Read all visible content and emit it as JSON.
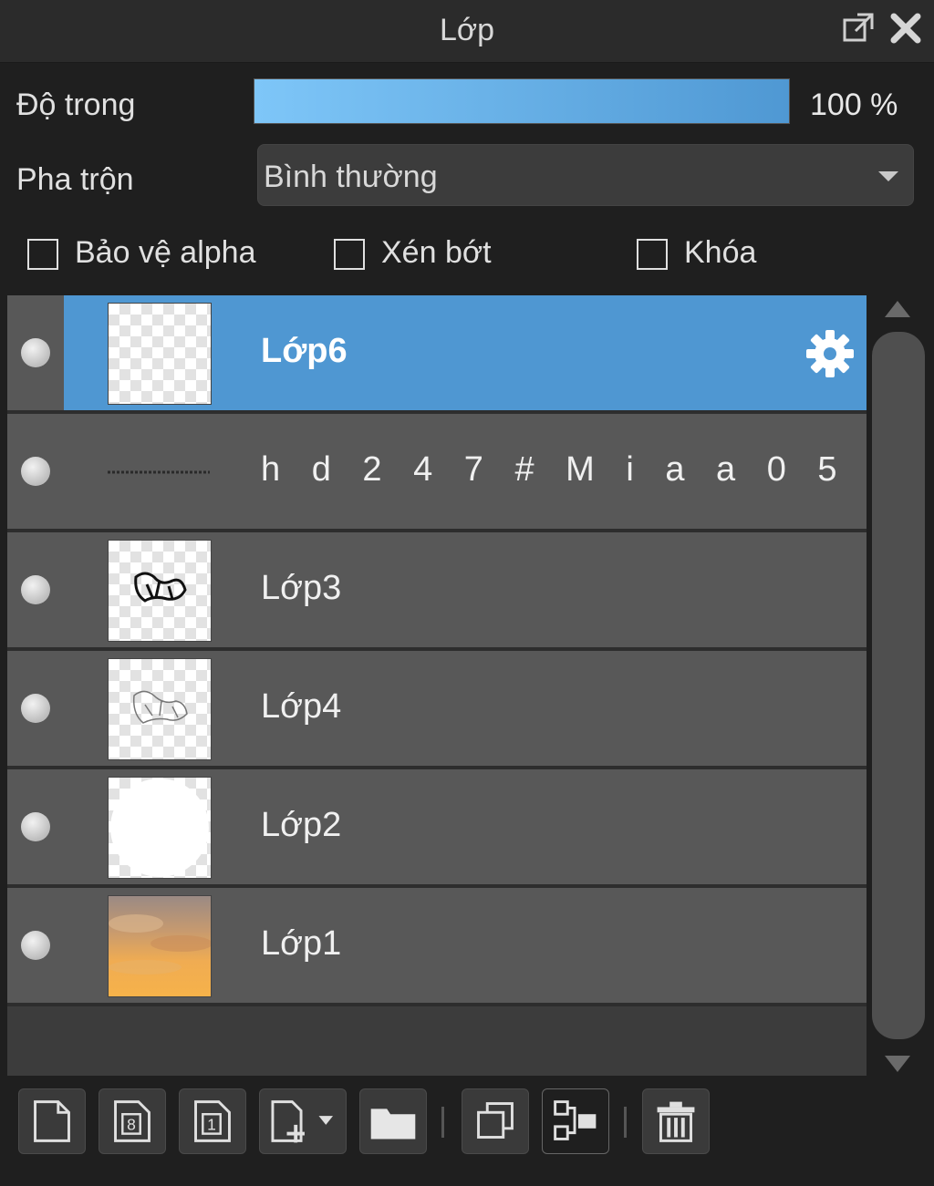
{
  "window": {
    "title": "Lớp"
  },
  "opacity": {
    "label": "Độ trong",
    "value_text": "100 %",
    "value": 100
  },
  "blend": {
    "label": "Pha trộn",
    "value": "Bình thường"
  },
  "checkboxes": [
    {
      "label": "Bảo vệ alpha",
      "checked": false
    },
    {
      "label": "Xén bớt",
      "checked": false
    },
    {
      "label": "Khóa",
      "checked": false
    }
  ],
  "layers": [
    {
      "name": "Lớp6",
      "selected": true,
      "thumb": "transparent"
    },
    {
      "name": "h d 2 4 7 #  M i a a 0 5",
      "selected": false,
      "thumb": "text-line"
    },
    {
      "name": "Lớp3",
      "selected": false,
      "thumb": "sketch"
    },
    {
      "name": "Lớp4",
      "selected": false,
      "thumb": "sketch-faint"
    },
    {
      "name": "Lớp2",
      "selected": false,
      "thumb": "white-circle"
    },
    {
      "name": "Lớp1",
      "selected": false,
      "thumb": "sky"
    }
  ],
  "toolbar_icons": [
    "new-layer-icon",
    "new-8bit-layer-icon",
    "new-1bit-layer-icon",
    "add-layer-menu-icon",
    "folder-icon",
    "duplicate-icon",
    "merge-down-icon",
    "trash-icon"
  ],
  "colors": {
    "selected": "#4f97d2",
    "layer_bg": "#585858",
    "panel_bg": "#1f1f1f"
  }
}
